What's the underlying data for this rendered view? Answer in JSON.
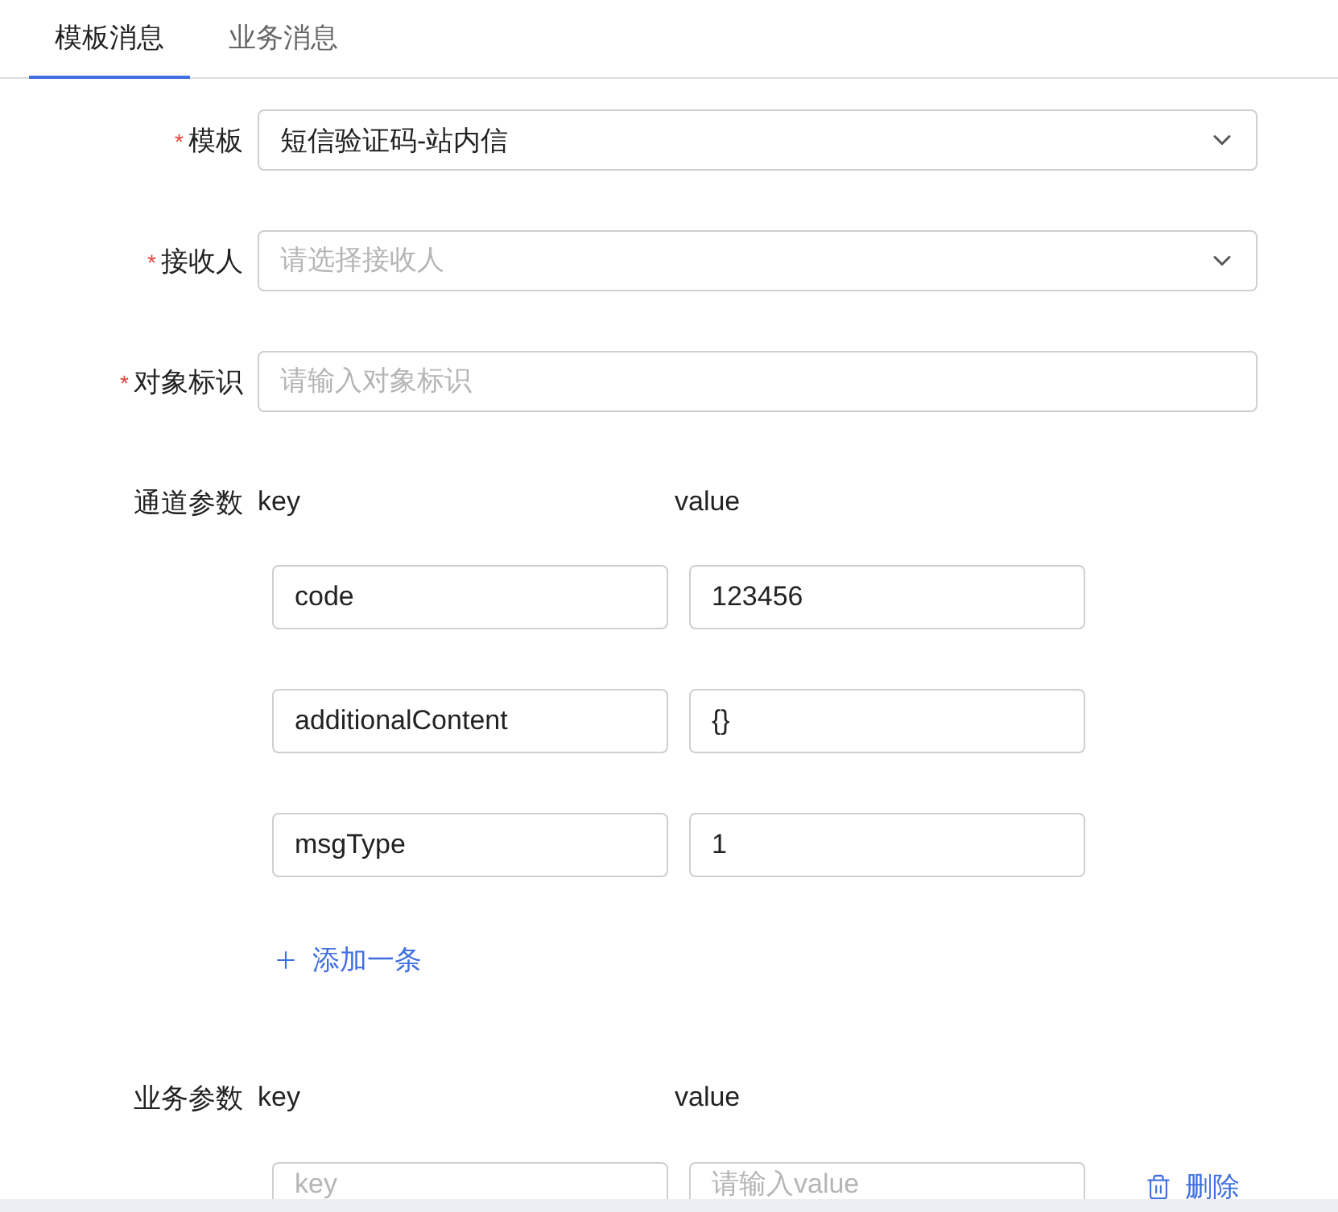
{
  "tabs": [
    {
      "label": "模板消息",
      "selected": true
    },
    {
      "label": "业务消息",
      "selected": false
    }
  ],
  "fields": [
    {
      "label": "模板",
      "required_mark": "*",
      "kind": "select",
      "value": "短信验证码-站内信"
    },
    {
      "label": "接收人",
      "required_mark": "*",
      "kind": "select",
      "placeholder": "请选择接收人"
    },
    {
      "label": "对象标识",
      "required_mark": "*",
      "kind": "input",
      "placeholder": "请输入对象标识"
    }
  ],
  "channel_params": {
    "label": "通道参数",
    "key_header": "key",
    "value_header": "value",
    "rows": [
      {
        "key": "code",
        "value": "123456"
      },
      {
        "key": "additionalContent",
        "value": "{}"
      },
      {
        "key": "msgType",
        "value": "1"
      }
    ],
    "add_button": "添加一条"
  },
  "business_params": {
    "label": "业务参数",
    "key_header": "key",
    "value_header": "value",
    "rows": [
      {
        "key_placeholder": "key",
        "value_placeholder": "请输入value",
        "delete_button": "删除"
      }
    ]
  }
}
